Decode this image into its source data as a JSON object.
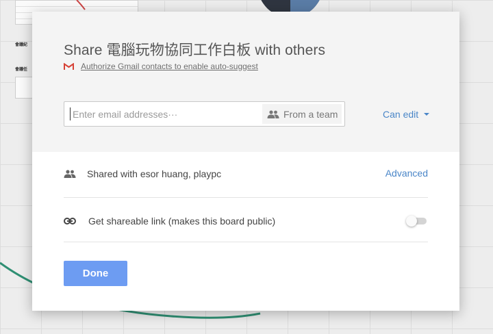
{
  "dialog": {
    "title": "Share 電腦玩物協同工作白板 with others",
    "gmail_link": "Authorize Gmail contacts to enable auto-suggest",
    "email_placeholder": "Enter email addresses···",
    "email_value": "",
    "from_team_label": "From a team",
    "permission_label": "Can edit",
    "shared_with_text": "Shared with esor huang, playpc",
    "advanced_label": "Advanced",
    "shareable_link_text": "Get shareable link (makes this board public)",
    "shareable_link_enabled": false,
    "done_label": "Done"
  },
  "icons": {
    "gmail": "gmail-icon",
    "people": "people-icon",
    "link": "link-icon",
    "caret": "caret-down-icon"
  },
  "colors": {
    "accent_link": "#4a86c8",
    "done_button": "#6d9cf2",
    "gmail_red": "#d64135",
    "header_background": "#f4f4f4"
  }
}
